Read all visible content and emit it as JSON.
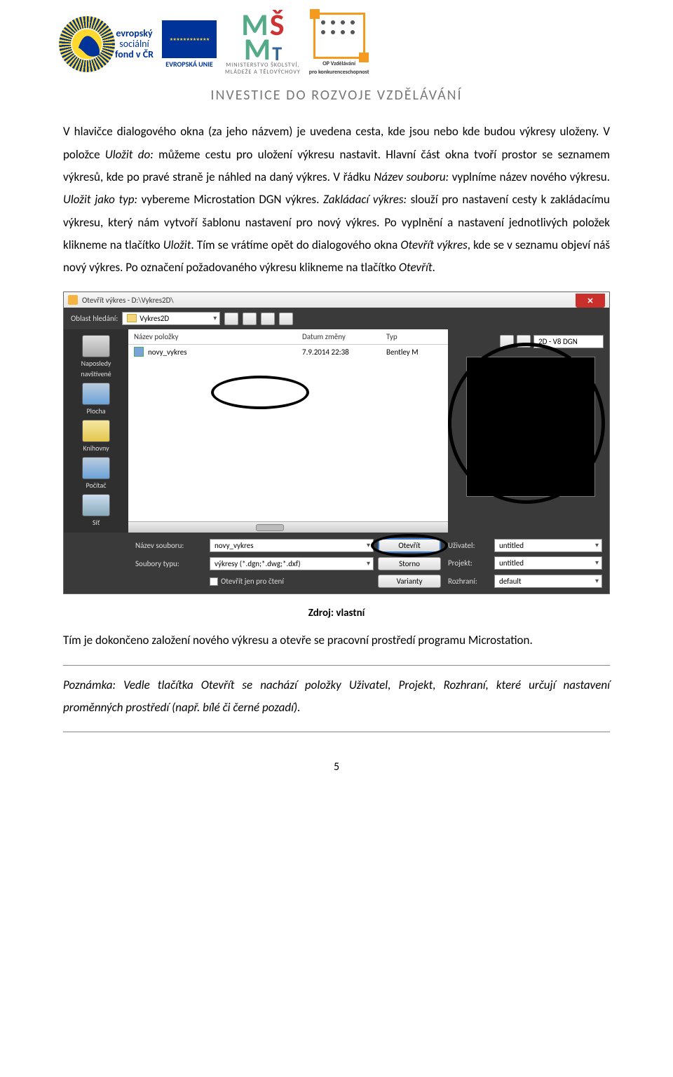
{
  "header": {
    "esf_line1": "evropský",
    "esf_line2": "sociální",
    "esf_line3": "fond v ČR",
    "eu_caption": "EVROPSKÁ UNIE",
    "msmt_line1": "MINISTERSTVO ŠKOLSTVÍ,",
    "msmt_line2": "MLÁDEŽE A TĚLOVÝCHOVY",
    "op_line1": "OP Vzdělávání",
    "op_line2": "pro konkurenceschopnost",
    "tagline": "INVESTICE DO ROZVOJE VZDĚLÁVÁNÍ"
  },
  "para1": "V hlavičce dialogového okna (za jeho názvem) je uvedena cesta, kde jsou nebo kde budou výkresy uloženy. V položce <em>Uložit do:</em> můžeme cestu pro uložení výkresu nastavit. Hlavní část okna tvoří prostor se seznamem výkresů, kde po pravé straně je náhled na daný výkres. V řádku <em>Název souboru:</em> vyplníme název nového výkresu. <em>Uložit jako typ:</em> vybereme Microstation DGN výkres. <em>Zakládací výkres:</em> slouží pro nastavení cesty k zakládacímu výkresu, který nám vytvoří šablonu nastavení pro nový výkres. Po vyplnění a nastavení jednotlivých položek klikneme na tlačítko <em>Uložit</em>. Tím se vrátíme opět do dialogového okna <em>Otevřít výkres</em>, kde se v seznamu objeví náš nový výkres. Po označení požadovaného výkresu klikneme na tlačítko <em>Otevřít</em>.",
  "dialog": {
    "title": "Otevřít výkres - D:\\Vykres2D\\",
    "lookin_label": "Oblast hledání:",
    "lookin_value": "Vykres2D",
    "preview_mode": "2D - V8 DGN",
    "columns": {
      "name": "Název položky",
      "date": "Datum změny",
      "type": "Typ"
    },
    "file": {
      "name": "novy_vykres",
      "date": "7.9.2014 22:38",
      "type": "Bentley M"
    },
    "places": {
      "recent1": "Naposledy",
      "recent2": "navštívené",
      "desktop": "Plocha",
      "libraries": "Knihovny",
      "computer": "Počítač",
      "network": "Síť"
    },
    "filename_label": "Název souboru:",
    "filename_value": "novy_vykres",
    "filetype_label": "Soubory typu:",
    "filetype_value": "výkresy (*.dgn;*.dwg;*.dxf)",
    "readonly_label": "Otevřít jen pro čtení",
    "open_btn": "Otevřít",
    "cancel_btn": "Storno",
    "variants_btn": "Varianty",
    "user_label": "Uživatel:",
    "user_value": "untitled",
    "project_label": "Projekt:",
    "project_value": "untitled",
    "interface_label": "Rozhraní:",
    "interface_value": "default"
  },
  "caption": "Zdroj: vlastní",
  "para2": "Tím je dokončeno založení nového výkresu a otevře se pracovní prostředí programu Microstation.",
  "note": "Poznámka: Vedle tlačítka Otevřít se nachází položky Uživatel, Projekt, Rozhraní, které určují nastavení proměnných prostředí (např. bílé či černé pozadí).",
  "page_number": "5"
}
